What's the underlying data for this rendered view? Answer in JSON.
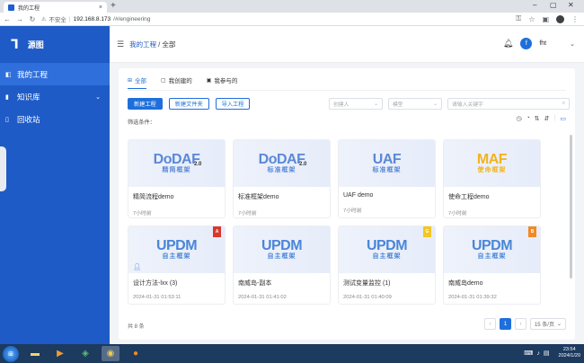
{
  "browser": {
    "tab_title": "我的工程",
    "tab_close": "×",
    "new_tab": "+",
    "min": "–",
    "max": "▢",
    "close": "✕",
    "insecure_label": "不安全",
    "url_host": "192.168.8.173",
    "url_path": "/#/engineering"
  },
  "sidebar": {
    "logo": "ᒣ",
    "brand": "源图",
    "items": [
      {
        "label": "我的工程",
        "icon": "project-icon"
      },
      {
        "label": "知识库",
        "icon": "library-icon",
        "arrow": "⌄"
      },
      {
        "label": "回收站",
        "icon": "trash-icon"
      }
    ]
  },
  "header": {
    "breadcrumb_root": "我的工程",
    "breadcrumb_sep": "/",
    "breadcrumb_current": "全部",
    "user_initial": "f",
    "user_name": "fht"
  },
  "tabs": [
    {
      "label": "全部",
      "active": true
    },
    {
      "label": "我创建的",
      "active": false
    },
    {
      "label": "我参与的",
      "active": false
    }
  ],
  "actions": {
    "new_project": "新建工程",
    "new_folder": "新建文件夹",
    "import_project": "导入工程"
  },
  "filters": {
    "creator_placeholder": "创建人",
    "type_placeholder": "模型",
    "search_placeholder": "请输入关键字",
    "filter_label": "筛选条件："
  },
  "cards": [
    {
      "logo": "DoDAF",
      "logo_sub": "精简框架",
      "ver": "2.0",
      "style": "dodaf",
      "name": "精简流程demo",
      "time": "7小时前"
    },
    {
      "logo": "DoDAF",
      "logo_sub": "标准框架",
      "ver": "2.0",
      "style": "dodaf",
      "name": "标准框架demo",
      "time": "7小时前"
    },
    {
      "logo": "UAF",
      "logo_sub": "标准框架",
      "ver": "",
      "style": "uaf",
      "name": "UAF demo",
      "time": "7小时前"
    },
    {
      "logo": "MAF",
      "logo_sub": "使命框架",
      "ver": "",
      "style": "maf",
      "name": "使命工程demo",
      "time": "7小时前"
    },
    {
      "logo": "UPDM",
      "logo_sub": "自主框架",
      "ver": "",
      "style": "updm",
      "badge": "A",
      "badge_color": "red",
      "user": true,
      "name": "设计方法-lxx (3)",
      "time": "2024-01-31 01:53:11"
    },
    {
      "logo": "UPDM",
      "logo_sub": "自主框架",
      "ver": "",
      "style": "updm",
      "name": "南威岛-副本",
      "time": "2024-01-31 01:41:02"
    },
    {
      "logo": "UPDM",
      "logo_sub": "自主框架",
      "ver": "",
      "style": "updm",
      "badge": "G",
      "badge_color": "yellow",
      "name": "测试变量监控 (1)",
      "time": "2024-01-31 01:40:09"
    },
    {
      "logo": "UPDM",
      "logo_sub": "自主框架",
      "ver": "",
      "style": "updm",
      "badge": "B",
      "badge_color": "orange",
      "name": "南威岛demo",
      "time": "2024-01-31 01:39:32"
    }
  ],
  "footer": {
    "total": "共 8 条",
    "prev": "‹",
    "page": "1",
    "next": "›",
    "page_size": "15 条/页"
  },
  "taskbar": {
    "time": "23:54",
    "date": "2024/1/20"
  }
}
